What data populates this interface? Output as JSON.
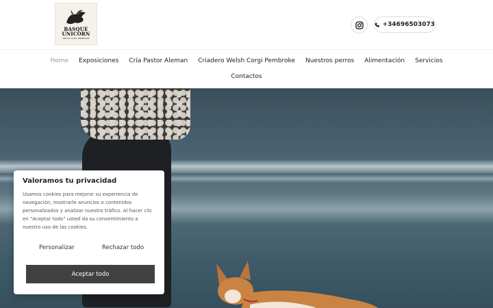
{
  "header": {
    "logo": {
      "line1": "BASQUE",
      "line2": "UNICORN",
      "tagline": "WELSH CORGI PEMBROKE"
    },
    "instagram_icon": "instagram-icon",
    "phone": {
      "icon": "phone-icon",
      "number": "+34696503073"
    }
  },
  "nav": {
    "items": [
      {
        "label": "Home",
        "active": true
      },
      {
        "label": "Exposiciones"
      },
      {
        "label": "Cría Pastor Aleman"
      },
      {
        "label": "Criadero Welsh Corgi Pembroke"
      },
      {
        "label": "Nuestros perros"
      },
      {
        "label": "Alimentación"
      },
      {
        "label": "Servicios"
      },
      {
        "label": "Contactos"
      }
    ]
  },
  "cookie": {
    "title": "Valoramos tu privacidad",
    "text": "Usamos cookies para mejorar su experiencia de navegación, mostrarle anuncios o contenidos personalizados y analizar nuestro tráfico. Al hacer clic en \"Aceptar todo\" usted da su consentimiento a nuestro uso de las cookies.",
    "personalize_label": "Personalizar",
    "reject_label": "Rechazar todo",
    "accept_label": "Aceptar todo"
  },
  "colors": {
    "accept_button": "#414141",
    "nav_active": "#999999"
  }
}
